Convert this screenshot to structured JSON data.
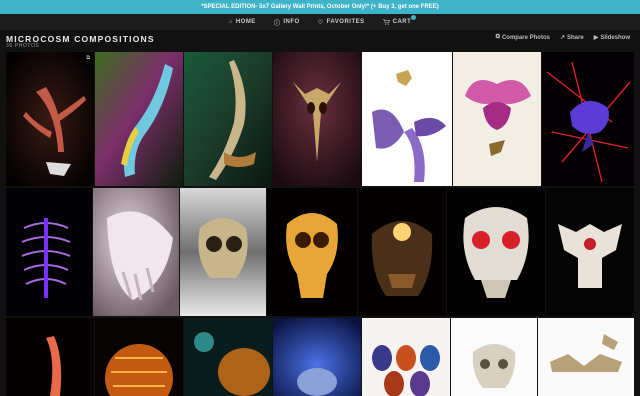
{
  "promo": {
    "text": "*SPECIAL EDITION- 5x7 Gallery Wall Prints, October Only!* (+ Buy 3, get one FREE)"
  },
  "nav": {
    "items": [
      {
        "label": "HOME",
        "icon": "home-icon",
        "glyph": "⌂"
      },
      {
        "label": "INFO",
        "icon": "info-icon",
        "glyph": "ⓘ"
      },
      {
        "label": "FAVORITES",
        "icon": "heart-icon",
        "glyph": "♡"
      },
      {
        "label": "CART",
        "icon": "cart-icon",
        "glyph": "🛒"
      }
    ]
  },
  "gallery": {
    "title": "MICROCOSM COMPOSITIONS",
    "count": "36 PHOTOS",
    "actions": [
      {
        "label": "Compare Photos",
        "icon": "compare-icon",
        "glyph": "⧉"
      },
      {
        "label": "Share",
        "icon": "share-icon",
        "glyph": "↗"
      },
      {
        "label": "Slideshow",
        "icon": "slideshow-icon",
        "glyph": "▶"
      }
    ]
  },
  "colors": {
    "accent": "#3fb4c8",
    "background": "#111111"
  }
}
